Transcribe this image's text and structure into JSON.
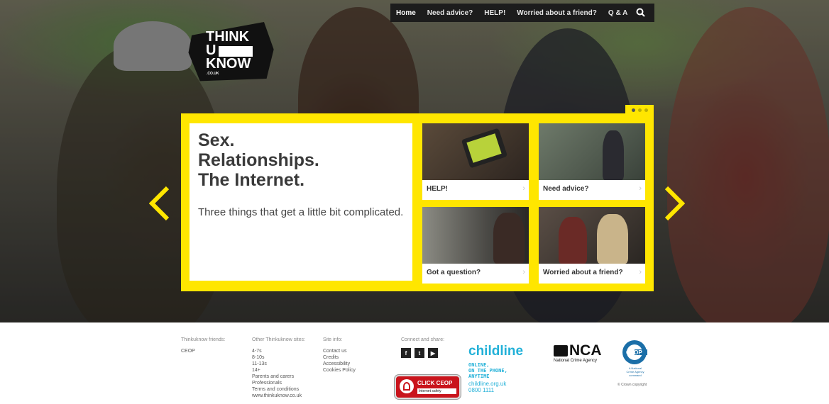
{
  "nav": {
    "items": [
      "Home",
      "Need advice?",
      "HELP!",
      "Worried about a friend?",
      "Q & A"
    ],
    "active": "Home",
    "search_icon": "search-icon"
  },
  "logo": {
    "line1": "THINK",
    "line2": "U",
    "line3": "KNOW",
    "line4": ".CO.UK"
  },
  "hero": {
    "title_line1": "Sex.",
    "title_line2": "Relationships.",
    "title_line3": "The Internet.",
    "subtitle": "Three things that get a little bit complicated.",
    "tiles": [
      {
        "label": "HELP!"
      },
      {
        "label": "Need advice?"
      },
      {
        "label": "Got a question?"
      },
      {
        "label": "Worried about a friend?"
      }
    ],
    "accent_color": "#ffe600",
    "carousel_slides": 3,
    "carousel_active": 1
  },
  "footer": {
    "friends": {
      "heading": "Thinkuknow friends:",
      "links": [
        "CEOP"
      ]
    },
    "other_sites": {
      "heading": "Other Thinkuknow sites:",
      "links": [
        "4-7s",
        "8-10s",
        "11-13s",
        "14+",
        "Parents and carers",
        "Professionals",
        "Terms and conditions",
        "www.thinkuknow.co.uk"
      ]
    },
    "site_info": {
      "heading": "Site info:",
      "links": [
        "Contact us",
        "Credits",
        "Accessibility",
        "Cookies Policy"
      ]
    },
    "connect": {
      "heading": "Connect and share:",
      "icons": [
        "facebook-icon",
        "twitter-icon",
        "youtube-icon"
      ]
    },
    "click_ceop": {
      "line1": "CLICK CEOP",
      "line2": "Internet safety"
    },
    "childline": {
      "name": "childline",
      "tag1": "ONLINE,",
      "tag2": "ON THE PHONE,",
      "tag3": "ANYTIME",
      "url": "childline.org.uk",
      "phone": "0800 1111"
    },
    "nca": {
      "name": "NCA",
      "sub": "National Crime Agency"
    },
    "ceop": {
      "name": "CEOP",
      "sub1": "A National",
      "sub2": "Crime Agency",
      "sub3": "command",
      "copyright": "© Crown copyright"
    }
  }
}
